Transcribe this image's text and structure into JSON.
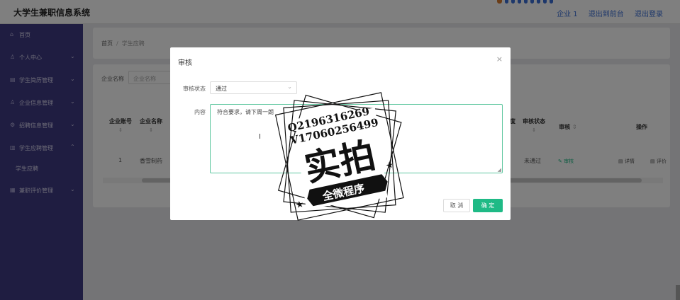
{
  "app": {
    "title": "大学生兼职信息系统"
  },
  "header_links": [
    "企业 1",
    "退出到前台",
    "退出登录"
  ],
  "sidebar": {
    "items": [
      {
        "label": "首页",
        "icon": "home-icon",
        "glyph": "⌂",
        "chevron": false
      },
      {
        "label": "个人中心",
        "icon": "user-icon",
        "glyph": "♙",
        "chevron": true
      },
      {
        "label": "学生简历管理",
        "icon": "list-icon",
        "glyph": "▤",
        "chevron": true
      },
      {
        "label": "企业信息管理",
        "icon": "user-icon",
        "glyph": "♙",
        "chevron": true
      },
      {
        "label": "招聘信息管理",
        "icon": "settings-icon",
        "glyph": "⚙",
        "chevron": true
      },
      {
        "label": "学生应聘管理",
        "icon": "document-icon",
        "glyph": "▥",
        "chevron": true
      },
      {
        "label": "学生应聘",
        "icon": "",
        "glyph": "",
        "chevron": false
      },
      {
        "label": "兼职评价管理",
        "icon": "grid-icon",
        "glyph": "▦",
        "chevron": true
      }
    ]
  },
  "breadcrumb": {
    "home": "首页",
    "sep": "/",
    "current": "学生应聘"
  },
  "filter": {
    "label": "企业名称",
    "placeholder": "企业名称"
  },
  "table": {
    "headers": {
      "company_account": "企业账号",
      "company_name": "企业名称",
      "audit_status": "审核状态",
      "audit": "审核",
      "actions": "操作",
      "sort_icon": "⇕",
      "partial": "度"
    },
    "row": {
      "company_account": "1",
      "company_name": "香雪制药",
      "audit_status": "未通过",
      "audit_link": "✎ 审核",
      "detail": "▤ 详情",
      "evaluate": "▤ 评价"
    }
  },
  "dialog": {
    "title": "审核",
    "close": "×",
    "status_label": "审核状态",
    "status_value": "通过",
    "content_label": "内容",
    "content_value": "符合要求，请下周一朗",
    "cancel_label": "取 消",
    "ok_label": "确 定"
  },
  "watermark": {
    "line1": "Q2196316269",
    "line2": "V17060256499",
    "big": "实拍",
    "banner": "全微程序"
  },
  "colors": {
    "sidebar": "#3f3a82",
    "accent": "#1fba86",
    "link": "#3a6ed6"
  }
}
